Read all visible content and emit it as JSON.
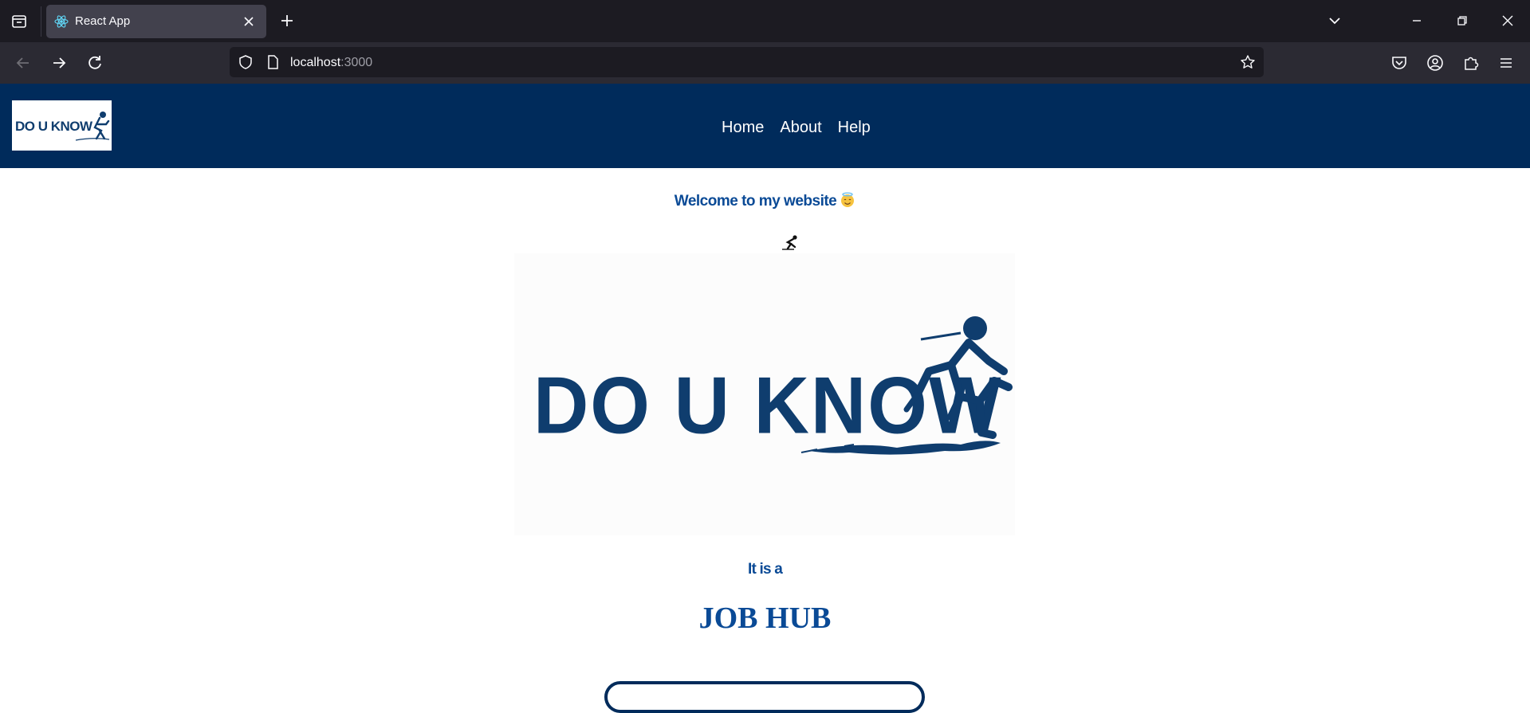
{
  "browser": {
    "tab_title": "React App",
    "url_host": "localhost",
    "url_port": ":3000"
  },
  "site": {
    "logo_text": "DO U KNOW",
    "nav": [
      {
        "label": "Home"
      },
      {
        "label": "About"
      },
      {
        "label": "Help"
      }
    ],
    "welcome_text": "Welcome to my website",
    "tagline_small": "It is a",
    "tagline_big": "JOB HUB"
  },
  "colors": {
    "brand_navy": "#002b5b",
    "text_blue": "#0a4a96",
    "chrome_dark": "#1c1b22",
    "chrome_toolbar": "#2b2a33"
  }
}
